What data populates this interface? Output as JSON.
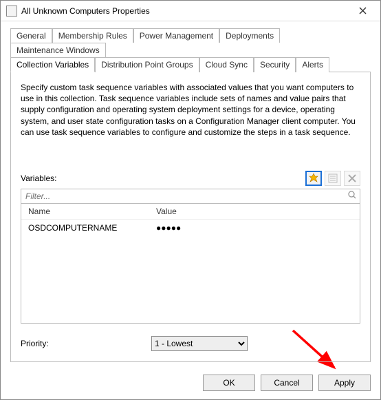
{
  "window": {
    "title": "All Unknown Computers Properties",
    "close_icon_name": "close-icon"
  },
  "tabs_row1": [
    {
      "label": "General"
    },
    {
      "label": "Membership Rules"
    },
    {
      "label": "Power Management"
    },
    {
      "label": "Deployments"
    },
    {
      "label": "Maintenance Windows"
    }
  ],
  "tabs_row2": [
    {
      "label": "Collection Variables",
      "active": true
    },
    {
      "label": "Distribution Point Groups"
    },
    {
      "label": "Cloud Sync"
    },
    {
      "label": "Security"
    },
    {
      "label": "Alerts"
    }
  ],
  "panel": {
    "description": "Specify custom task sequence variables with associated values that you want computers to use in this collection. Task sequence variables include sets of names and value pairs that supply configuration and operating system deployment settings for a device, operating system, and user state configuration tasks on a Configuration Manager client computer. You can use task sequence variables to configure and customize the steps in a task sequence.",
    "variables_label": "Variables:",
    "filter_placeholder": "Filter...",
    "columns": {
      "name": "Name",
      "value": "Value"
    },
    "rows": [
      {
        "name": "OSDCOMPUTERNAME",
        "value": "●●●●●"
      }
    ],
    "toolbar": {
      "new_icon": "new-starburst-icon",
      "edit_icon": "properties-icon",
      "delete_icon": "delete-icon"
    },
    "priority_label": "Priority:",
    "priority_value": "1 - Lowest"
  },
  "buttons": {
    "ok": "OK",
    "cancel": "Cancel",
    "apply": "Apply"
  },
  "annotation": {
    "arrow_color": "#ff0000"
  }
}
